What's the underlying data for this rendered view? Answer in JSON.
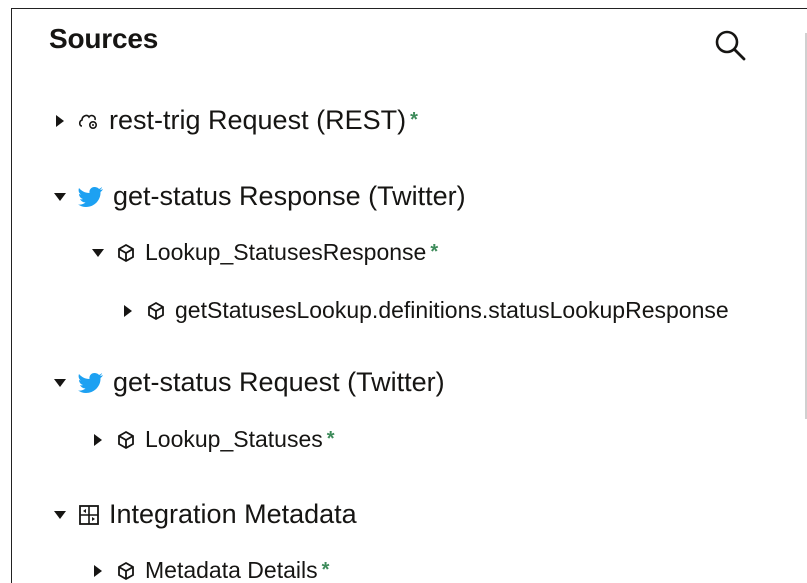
{
  "panel": {
    "title": "Sources"
  },
  "tree": {
    "rest_request": {
      "label": "rest-trig Request (REST)",
      "star": "*"
    },
    "status_response": {
      "label": "get-status Response (Twitter)"
    },
    "lookup_statuses_response": {
      "label": "Lookup_StatusesResponse",
      "star": "*"
    },
    "statuses_lookup_def": {
      "label": "getStatusesLookup.definitions.statusLookupResponse"
    },
    "status_request": {
      "label": "get-status Request (Twitter)"
    },
    "lookup_statuses": {
      "label": "Lookup_Statuses",
      "star": "*"
    },
    "integration_metadata": {
      "label": "Integration Metadata"
    },
    "metadata_details": {
      "label": "Metadata Details",
      "star": "*"
    }
  },
  "icons": {
    "rest": "rest-endpoint-icon",
    "twitter": "twitter-icon",
    "object": "object-cube-icon",
    "metadata": "metadata-grid-icon",
    "search": "search-icon"
  },
  "colors": {
    "twitter": "#1da1f2",
    "required_star": "#3d8b5a"
  }
}
